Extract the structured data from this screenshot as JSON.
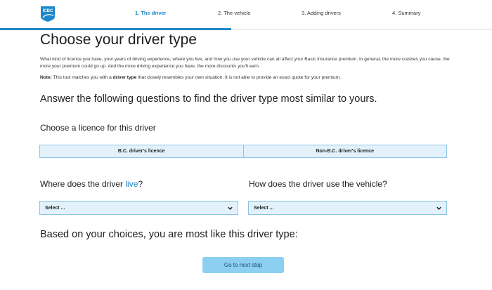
{
  "header": {
    "logo_text": "ICBC",
    "steps": [
      {
        "label": "1. The driver",
        "active": true
      },
      {
        "label": "2. The vehicle",
        "active": false
      },
      {
        "label": "3. Adding drivers",
        "active": false
      },
      {
        "label": "4. Summary",
        "active": false
      }
    ],
    "progress_fraction": 0.47
  },
  "page_title": "Choose your driver type",
  "intro": "What kind of licence you have, your years of driving experience, where you live, and how you use your vehicle can all affect your Basic insurance premium. In general, the more crashes you cause, the more your premium could go up. And the more driving experience you have, the more discounts you'll earn.",
  "note": {
    "label": "Note:",
    "text_before": " This tool matches you with a ",
    "bold": "driver type",
    "text_after": " that closely resembles your own situation. It is not able to provide an exact quote for your premium."
  },
  "main_question": "Answer the following questions to find the driver type most similar to yours.",
  "licence": {
    "label": "Choose a licence for this driver",
    "options": [
      "B.C. driver's licence",
      "Non-B.C. driver's licence"
    ]
  },
  "live_question": {
    "before": "Where does the driver ",
    "link": "live",
    "after": "?",
    "select_value": "Select ..."
  },
  "use_question": {
    "label": "How does the driver use the vehicle?",
    "select_value": "Select ..."
  },
  "result_label": "Based on your choices, you are most like this driver type:",
  "next_button": "Go to next step",
  "colors": {
    "accent": "#1f87c9",
    "option_bg": "#e3f1fb",
    "option_border": "#8cc4e6",
    "button_bg": "#8ccff0"
  }
}
